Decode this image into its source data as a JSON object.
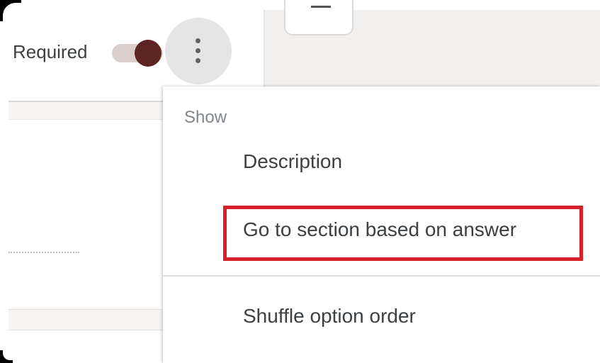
{
  "question": {
    "required_label": "Required",
    "required_on": true
  },
  "menu": {
    "header": "Show",
    "items": [
      {
        "label": "Description"
      },
      {
        "label": "Go to section based on answer"
      },
      {
        "label": "Shuffle option order"
      }
    ]
  },
  "colors": {
    "toggle_knob": "#5e2422",
    "toggle_track": "#d9cfcc",
    "highlight": "#d71f26"
  },
  "icons": {
    "more": "more-vert-icon"
  }
}
